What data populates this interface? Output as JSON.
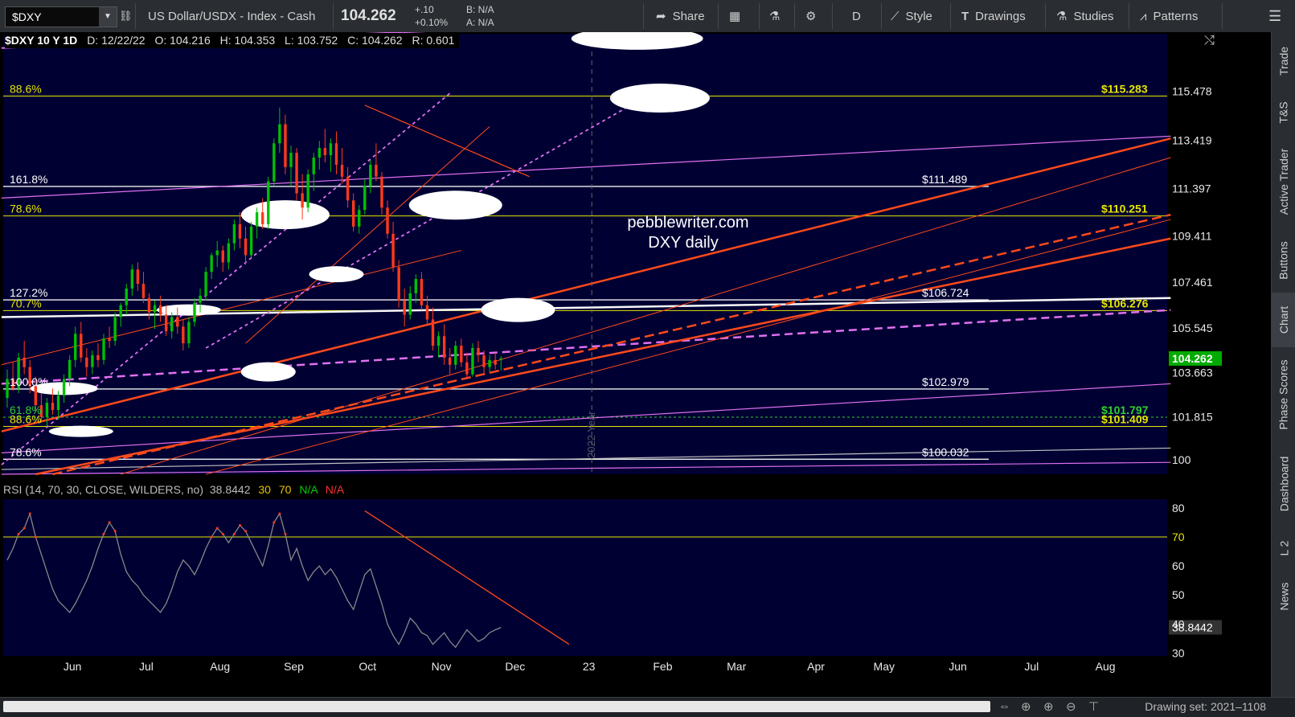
{
  "toolbar": {
    "symbol": "$DXY",
    "description": "US Dollar/USDX - Index - Cash",
    "last": "104.262",
    "change": "+.10",
    "change_pct": "+0.10%",
    "bid": "B: N/A",
    "ask": "A: N/A",
    "share": "Share",
    "period": "D",
    "style": "Style",
    "drawings": "Drawings",
    "studies": "Studies",
    "patterns": "Patterns"
  },
  "header": {
    "title": "$DXY 10 Y 1D",
    "date": "D: 12/22/22",
    "open": "O: 104.216",
    "high": "H: 104.353",
    "low": "L: 103.752",
    "close": "C: 104.262",
    "range": "R: 0.601"
  },
  "sidebar": [
    "Trade",
    "T&S",
    "Active Trader",
    "Buttons",
    "Chart",
    "Phase Scores",
    "Dashboard",
    "L 2",
    "News"
  ],
  "bottom": {
    "drawing_set": "Drawing set: 2021–1108"
  },
  "colors": {
    "background": "#000033",
    "up": "#00c000",
    "down": "#ff3a1a",
    "fib_yellow": "#e6e600",
    "trend_orange": "#ff4a1a",
    "channel_magenta": "#e070f0",
    "price_badge": "#00aa00"
  },
  "chart_data": [
    {
      "type": "candlestick",
      "title": "$DXY 10 Y 1D",
      "x_labels": [
        "Jun",
        "Jul",
        "Aug",
        "Sep",
        "Oct",
        "Nov",
        "Dec",
        "23",
        "Feb",
        "Mar",
        "Apr",
        "May",
        "Jun",
        "Jul",
        "Aug"
      ],
      "y_ticks": [
        100,
        101.815,
        103.663,
        105.545,
        107.461,
        109.411,
        111.397,
        113.419,
        115.478
      ],
      "y_tick_labels": [
        "100",
        "101.815",
        "103.663",
        "105.545",
        "107.461",
        "109.411",
        "111.397",
        "113.419",
        "115.478"
      ],
      "ylim": [
        99.4,
        117.9
      ],
      "last_price": 104.262,
      "last_price_label": "104.262",
      "year_marker": "2022 Year",
      "watermark": [
        "pebblewriter.com",
        "DXY daily"
      ],
      "fib_levels": [
        {
          "label": "88.6%",
          "price": 115.283,
          "price_label": "$115.283",
          "color": "yellow"
        },
        {
          "label": "161.8%",
          "price": 111.489,
          "price_label": "$111.489",
          "color": "white"
        },
        {
          "label": "78.6%",
          "price": 110.251,
          "price_label": "$110.251",
          "color": "yellow"
        },
        {
          "label": "127.2%",
          "price": 106.724,
          "price_label": "$106.724",
          "color": "white"
        },
        {
          "label": "70.7%",
          "price": 106.276,
          "price_label": "$106.276",
          "color": "yellow"
        },
        {
          "label": "100.0%",
          "price": 102.979,
          "price_label": "$102.979",
          "color": "white"
        },
        {
          "label": "61.8%",
          "price": 101.797,
          "price_label": "$101.797",
          "color": "green-dotted"
        },
        {
          "label": "88.6%",
          "price": 101.409,
          "price_label": "$101.409",
          "color": "yellow"
        },
        {
          "label": "78.6%",
          "price": 100.032,
          "price_label": "$100.032",
          "color": "white"
        }
      ],
      "ohlc": [
        [
          102.6,
          103.8,
          102.2,
          103.4
        ],
        [
          103.4,
          104.1,
          102.9,
          103.0
        ],
        [
          103.0,
          104.5,
          102.8,
          104.3
        ],
        [
          104.3,
          105.0,
          103.6,
          103.9
        ],
        [
          103.9,
          104.2,
          102.8,
          103.1
        ],
        [
          103.1,
          103.5,
          102.0,
          102.3
        ],
        [
          102.3,
          102.8,
          101.6,
          101.8
        ],
        [
          101.8,
          102.6,
          101.4,
          102.4
        ],
        [
          102.4,
          103.0,
          101.9,
          102.1
        ],
        [
          102.1,
          102.9,
          101.7,
          102.7
        ],
        [
          102.7,
          103.6,
          102.4,
          103.4
        ],
        [
          103.4,
          104.4,
          103.1,
          104.2
        ],
        [
          104.2,
          105.6,
          103.9,
          105.3
        ],
        [
          105.3,
          105.8,
          104.1,
          104.3
        ],
        [
          104.3,
          104.7,
          103.5,
          103.9
        ],
        [
          103.9,
          104.6,
          103.6,
          104.4
        ],
        [
          104.4,
          104.9,
          103.9,
          104.2
        ],
        [
          104.2,
          105.3,
          104.0,
          105.1
        ],
        [
          105.1,
          105.6,
          104.7,
          105.0
        ],
        [
          105.0,
          106.2,
          104.8,
          106.0
        ],
        [
          106.0,
          106.6,
          105.6,
          106.5
        ],
        [
          106.5,
          107.4,
          106.1,
          107.2
        ],
        [
          107.2,
          108.2,
          106.9,
          108.0
        ],
        [
          108.0,
          108.3,
          107.1,
          107.4
        ],
        [
          107.4,
          107.9,
          106.6,
          106.8
        ],
        [
          106.8,
          107.0,
          105.9,
          106.2
        ],
        [
          106.2,
          106.7,
          105.5,
          106.5
        ],
        [
          106.5,
          106.9,
          105.8,
          106.1
        ],
        [
          106.1,
          106.5,
          105.2,
          105.4
        ],
        [
          105.4,
          106.2,
          105.1,
          106.0
        ],
        [
          106.0,
          106.4,
          105.3,
          105.6
        ],
        [
          105.6,
          105.9,
          104.6,
          104.9
        ],
        [
          104.9,
          106.0,
          104.7,
          105.8
        ],
        [
          105.8,
          106.8,
          105.6,
          106.6
        ],
        [
          106.6,
          107.2,
          106.2,
          106.9
        ],
        [
          106.9,
          108.1,
          106.7,
          107.9
        ],
        [
          107.9,
          108.7,
          107.6,
          108.6
        ],
        [
          108.6,
          109.2,
          108.1,
          108.8
        ],
        [
          108.8,
          109.0,
          107.9,
          108.3
        ],
        [
          108.3,
          109.3,
          108.0,
          109.1
        ],
        [
          109.1,
          110.1,
          108.8,
          109.9
        ],
        [
          109.9,
          110.4,
          108.9,
          109.3
        ],
        [
          109.3,
          109.8,
          108.2,
          108.6
        ],
        [
          108.6,
          110.0,
          108.5,
          109.8
        ],
        [
          109.8,
          110.6,
          109.3,
          110.4
        ],
        [
          110.4,
          111.0,
          109.7,
          109.9
        ],
        [
          109.9,
          111.9,
          109.7,
          111.7
        ],
        [
          111.7,
          113.5,
          111.5,
          113.3
        ],
        [
          113.3,
          114.8,
          112.9,
          114.1
        ],
        [
          114.1,
          114.5,
          112.0,
          112.3
        ],
        [
          112.3,
          113.2,
          111.5,
          112.9
        ],
        [
          112.9,
          113.1,
          110.9,
          111.2
        ],
        [
          111.2,
          112.0,
          110.1,
          110.6
        ],
        [
          110.6,
          112.2,
          110.4,
          112.0
        ],
        [
          112.0,
          112.9,
          111.3,
          112.7
        ],
        [
          112.7,
          113.4,
          112.2,
          113.1
        ],
        [
          113.1,
          113.9,
          112.5,
          112.8
        ],
        [
          112.8,
          113.5,
          112.1,
          113.3
        ],
        [
          113.3,
          113.8,
          112.0,
          112.4
        ],
        [
          112.4,
          113.1,
          111.6,
          111.9
        ],
        [
          111.9,
          112.3,
          110.6,
          110.9
        ],
        [
          110.9,
          111.2,
          109.6,
          109.8
        ],
        [
          109.8,
          110.7,
          109.5,
          110.5
        ],
        [
          110.5,
          111.8,
          110.3,
          111.5
        ],
        [
          111.5,
          112.6,
          111.2,
          112.4
        ],
        [
          112.4,
          113.3,
          111.7,
          111.9
        ],
        [
          111.9,
          112.1,
          110.3,
          110.6
        ],
        [
          110.6,
          110.9,
          109.3,
          109.5
        ],
        [
          109.5,
          110.0,
          107.9,
          108.1
        ],
        [
          108.1,
          108.4,
          106.4,
          106.7
        ],
        [
          106.7,
          107.2,
          105.6,
          106.1
        ],
        [
          106.1,
          107.3,
          105.9,
          107.0
        ],
        [
          107.0,
          107.8,
          106.6,
          107.6
        ],
        [
          107.6,
          107.9,
          106.3,
          106.5
        ],
        [
          106.5,
          106.9,
          105.7,
          105.9
        ],
        [
          105.9,
          106.4,
          104.6,
          104.8
        ],
        [
          104.8,
          105.4,
          104.3,
          105.2
        ],
        [
          105.2,
          105.7,
          104.0,
          104.3
        ],
        [
          104.3,
          104.7,
          103.6,
          104.0
        ],
        [
          104.0,
          105.0,
          103.8,
          104.8
        ],
        [
          104.8,
          105.1,
          103.9,
          104.1
        ],
        [
          104.1,
          104.5,
          103.4,
          103.6
        ],
        [
          103.6,
          104.9,
          103.5,
          104.7
        ],
        [
          104.7,
          105.0,
          104.1,
          104.4
        ],
        [
          104.4,
          104.6,
          103.6,
          103.9
        ],
        [
          103.9,
          104.4,
          103.7,
          104.2
        ],
        [
          104.2,
          104.5,
          103.8,
          104.0
        ],
        [
          104.216,
          104.353,
          103.752,
          104.262
        ]
      ]
    },
    {
      "type": "line",
      "title": "RSI (14, 70, 30, CLOSE, WILDERS, no)",
      "readouts": [
        "38.8442",
        "30",
        "70",
        "N/A",
        "N/A"
      ],
      "y_ticks": [
        30,
        40,
        50,
        60,
        70,
        80
      ],
      "ylim": [
        29,
        83
      ],
      "overbought": 70,
      "last_value": 38.8442,
      "last_value_label": "38.8442",
      "series": [
        {
          "values": [
            62,
            66,
            71,
            73,
            78,
            70,
            64,
            58,
            52,
            48,
            46,
            44,
            47,
            51,
            55,
            60,
            66,
            71,
            75,
            72,
            64,
            58,
            55,
            53,
            50,
            48,
            46,
            44,
            47,
            52,
            58,
            62,
            60,
            57,
            61,
            66,
            70,
            73,
            71,
            68,
            71,
            74,
            72,
            68,
            64,
            60,
            67,
            75,
            78,
            71,
            62,
            66,
            60,
            55,
            58,
            60,
            57,
            59,
            56,
            52,
            48,
            45,
            51,
            57,
            59,
            53,
            47,
            40,
            36,
            33,
            37,
            42,
            40,
            37,
            36,
            33,
            35,
            37,
            34,
            32,
            35,
            38,
            36,
            34,
            35,
            37,
            38,
            38.8
          ]
        }
      ]
    }
  ]
}
